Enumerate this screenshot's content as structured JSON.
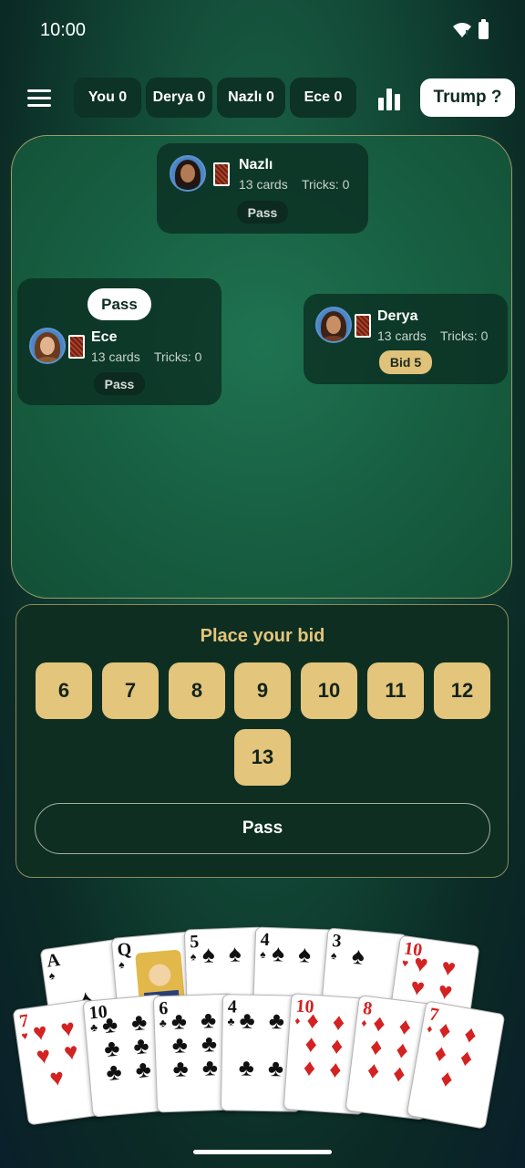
{
  "status": {
    "time": "10:00"
  },
  "scores": [
    {
      "label": "You 0"
    },
    {
      "label": "Derya 0"
    },
    {
      "label": "Nazlı 0"
    },
    {
      "label": "Ece 0"
    }
  ],
  "trump_label": "Trump ?",
  "players": {
    "nazli": {
      "name": "Nazlı",
      "cards": "13 cards",
      "tricks": "Tricks: 0",
      "badge": "Pass"
    },
    "ece": {
      "name": "Ece",
      "cards": "13 cards",
      "tricks": "Tricks: 0",
      "badge": "Pass",
      "speech": "Pass"
    },
    "derya": {
      "name": "Derya",
      "cards": "13 cards",
      "tricks": "Tricks: 0",
      "badge": "Bid 5"
    }
  },
  "bid": {
    "title": "Place your bid",
    "options": [
      "6",
      "7",
      "8",
      "9",
      "10",
      "11",
      "12",
      "13"
    ],
    "pass_label": "Pass"
  },
  "hand": [
    {
      "rank": "A",
      "suit": "♠",
      "color": "black"
    },
    {
      "rank": "Q",
      "suit": "♠",
      "color": "black"
    },
    {
      "rank": "5",
      "suit": "♠",
      "color": "black"
    },
    {
      "rank": "4",
      "suit": "♠",
      "color": "black"
    },
    {
      "rank": "3",
      "suit": "♠",
      "color": "black"
    },
    {
      "rank": "10",
      "suit": "♥",
      "color": "red"
    },
    {
      "rank": "7",
      "suit": "♥",
      "color": "red"
    },
    {
      "rank": "10",
      "suit": "♣",
      "color": "black"
    },
    {
      "rank": "6",
      "suit": "♣",
      "color": "black"
    },
    {
      "rank": "4",
      "suit": "♣",
      "color": "black"
    },
    {
      "rank": "10",
      "suit": "♦",
      "color": "red"
    },
    {
      "rank": "8",
      "suit": "♦",
      "color": "red"
    },
    {
      "rank": "7",
      "suit": "♦",
      "color": "red"
    }
  ],
  "colors": {
    "gold": "#e3c57c",
    "table": "#186043",
    "panel": "#0e2e22"
  }
}
